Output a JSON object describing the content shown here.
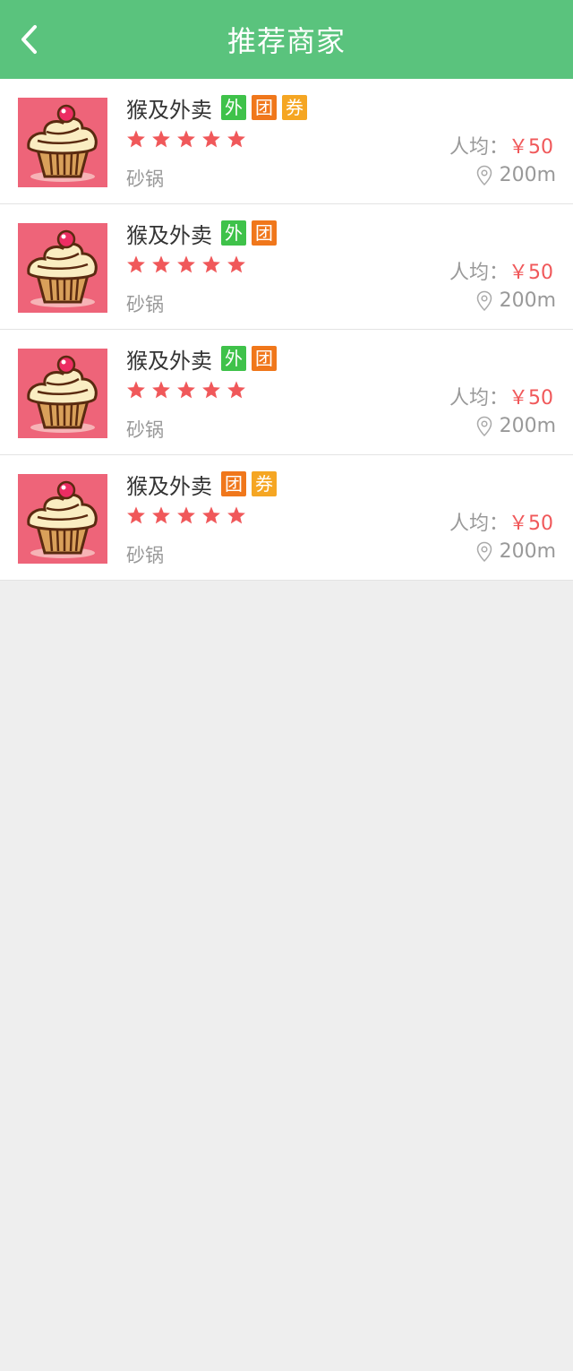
{
  "header": {
    "title": "推荐商家"
  },
  "colors": {
    "accent": "#5ac37d",
    "price": "#f0585a",
    "star": "#f0585a"
  },
  "tag_colors": {
    "外": "#3fc24a",
    "团": "#f0771b",
    "券": "#f5a623"
  },
  "merchants": [
    {
      "name": "猴及外卖",
      "tags": [
        "外",
        "团",
        "券"
      ],
      "rating": 5,
      "price_label": "人均：",
      "price": "￥50",
      "category": "砂锅",
      "distance": "200m",
      "image": "cupcake-image"
    },
    {
      "name": "猴及外卖",
      "tags": [
        "外",
        "团"
      ],
      "rating": 5,
      "price_label": "人均：",
      "price": "￥50",
      "category": "砂锅",
      "distance": "200m",
      "image": "cupcake-image"
    },
    {
      "name": "猴及外卖",
      "tags": [
        "外",
        "团"
      ],
      "rating": 5,
      "price_label": "人均：",
      "price": "￥50",
      "category": "砂锅",
      "distance": "200m",
      "image": "cupcake-image"
    },
    {
      "name": "猴及外卖",
      "tags": [
        "团",
        "券"
      ],
      "rating": 5,
      "price_label": "人均：",
      "price": "￥50",
      "category": "砂锅",
      "distance": "200m",
      "image": "cupcake-image"
    }
  ]
}
